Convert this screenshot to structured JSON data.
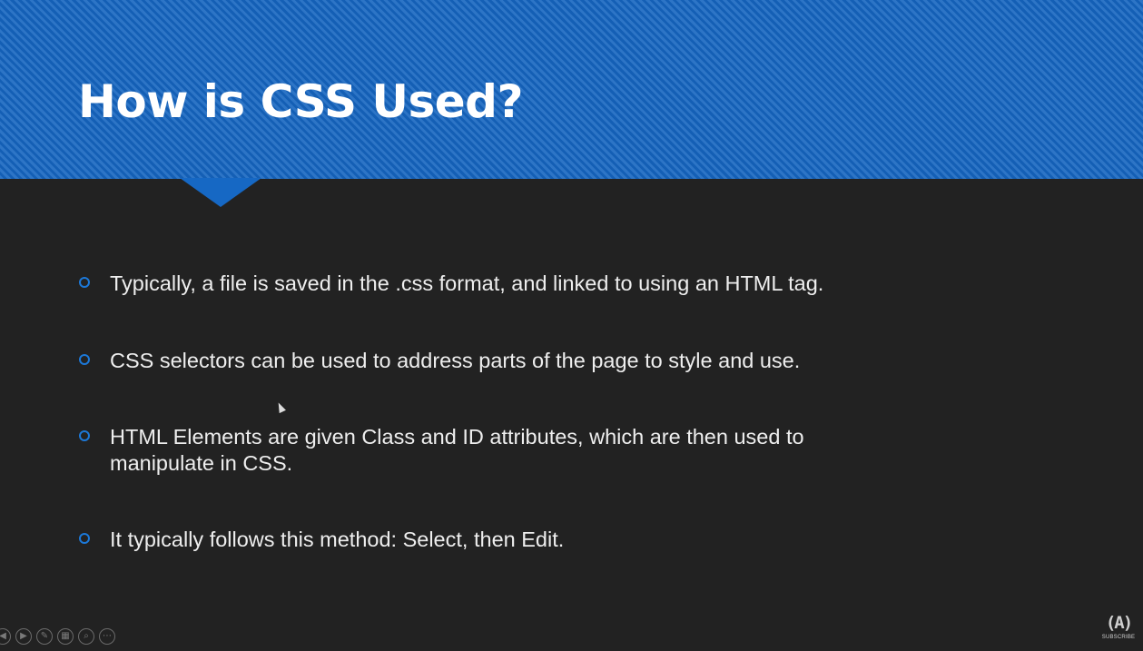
{
  "slide": {
    "title": "How is CSS Used?",
    "bullets": [
      "Typically, a file is saved in the .css format, and linked to using an HTML tag.",
      "CSS selectors can be used to address parts of the page to style and use.",
      "HTML Elements are given Class and ID attributes, which are then used to manipulate in CSS.",
      "It typically follows this method: Select, then Edit."
    ]
  },
  "toolbar": {
    "buttons": [
      {
        "name": "previous-slide",
        "icon": "arrow-left-icon",
        "glyph": "◀"
      },
      {
        "name": "next-slide",
        "icon": "arrow-right-icon",
        "glyph": "▶"
      },
      {
        "name": "pen-tool",
        "icon": "pen-icon",
        "glyph": "✎"
      },
      {
        "name": "see-all-slides",
        "icon": "slides-grid-icon",
        "glyph": "▦"
      },
      {
        "name": "zoom",
        "icon": "magnifier-icon",
        "glyph": "⌕"
      },
      {
        "name": "more-options",
        "icon": "ellipsis-icon",
        "glyph": "⋯"
      }
    ]
  },
  "watermark": {
    "mark": "(A)",
    "label": "SUBSCRIBE"
  },
  "colors": {
    "header_blue": "#1565c0",
    "bullet_blue": "#1c78d8",
    "background": "#222222",
    "text": "#eeeeee"
  }
}
